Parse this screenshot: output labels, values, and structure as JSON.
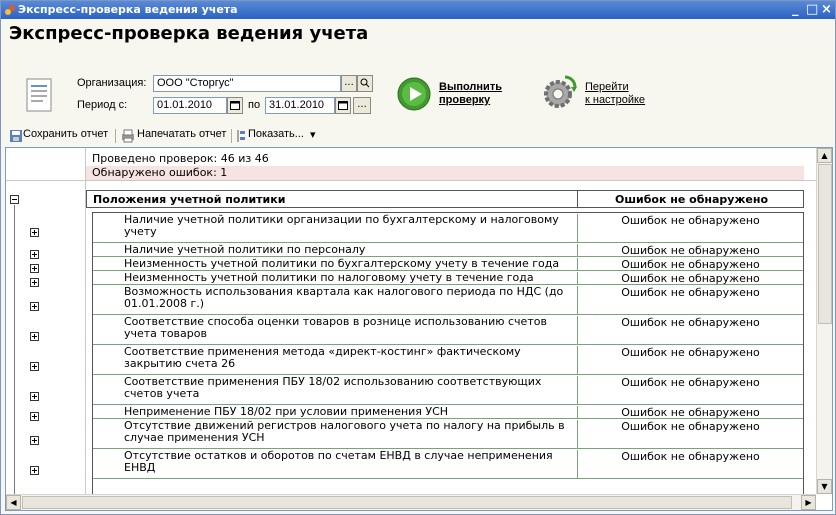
{
  "window": {
    "title": "Экспресс-проверка ведения учета",
    "controls": [
      "_",
      "□",
      "×"
    ]
  },
  "heading": "Экспресс-проверка ведения учета",
  "form": {
    "org_label": "Организация:",
    "org_value": "ООО \"Сторгус\"",
    "org_button": "...",
    "period_label": "Период с:",
    "date_from": "01.01.2010",
    "period_to_label": "по",
    "date_to": "31.01.2010",
    "date_button": "...",
    "run_link": "Выполнить проверку",
    "run_link_line1": "Выполнить",
    "run_link_line2": "проверку",
    "goto_link_line1": "Перейти",
    "goto_link_line2": "к настройке"
  },
  "toolbar": {
    "save_report": "Сохранить отчет",
    "print_report": "Напечатать отчет",
    "show": "Показать...",
    "show_arrow": "▾"
  },
  "report": {
    "checks_done": "Проведено проверок: 46 из 46",
    "errors_found": "Обнаружено ошибок: 1",
    "section": {
      "title": "Положения учетной политики",
      "status": "Ошибок не обнаружено"
    },
    "rows": [
      {
        "name": "Наличие учетной политики организации по бухгалтерскому и налоговому учету",
        "status": "Ошибок не обнаружено"
      },
      {
        "name": "Наличие учетной политики по персоналу",
        "status": "Ошибок не обнаружено"
      },
      {
        "name": "Неизменность учетной политики по бухгалтерскому учету в течение года",
        "status": "Ошибок не обнаружено"
      },
      {
        "name": "Неизменность учетной политики по налоговому учету в течение года",
        "status": "Ошибок не обнаружено"
      },
      {
        "name": "Возможность использования квартала как налогового периода по НДС (до 01.01.2008 г.)",
        "status": "Ошибок не обнаружено"
      },
      {
        "name": "Соответствие способа оценки товаров в рознице использованию счетов учета товаров",
        "status": "Ошибок не обнаружено"
      },
      {
        "name": "Соответствие применения метода «директ-костинг» фактическому закрытию счета 26",
        "status": "Ошибок не обнаружено"
      },
      {
        "name": "Соответствие применения ПБУ 18/02 использованию соответствующих счетов учета",
        "status": "Ошибок не обнаружено"
      },
      {
        "name": "Неприменение ПБУ 18/02  при условии применения УСН",
        "status": "Ошибок не обнаружено"
      },
      {
        "name": "Отсутствие движений регистров налогового учета по налогу на прибыль в случае применения УСН",
        "status": "Ошибок не обнаружено"
      },
      {
        "name": "Отсутствие остатков и оборотов по счетам ЕНВД в случае неприменения ЕНВД",
        "status": "Ошибок не обнаружено"
      }
    ]
  },
  "scrollbars": {
    "up": "▲",
    "down": "▼",
    "left": "◀",
    "right": "▶"
  }
}
